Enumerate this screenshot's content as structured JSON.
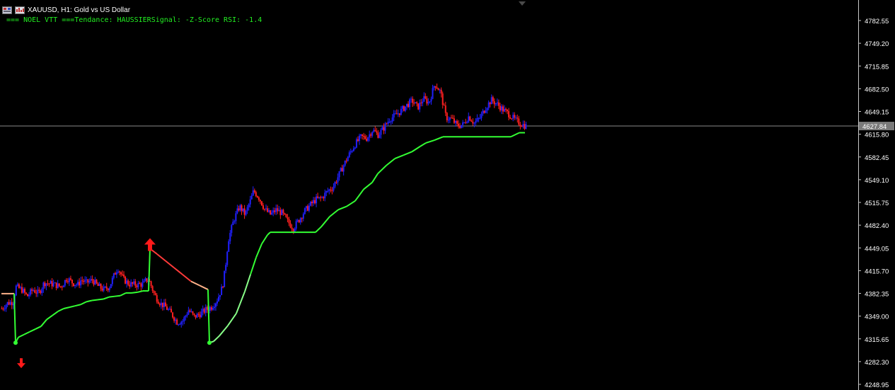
{
  "header": {
    "title": "XAUUSD, H1:  Gold vs US Dollar",
    "indicator_text": "=== NOEL VTT ===Tendance: HAUSSIERSignal: -Z-Score RSI: -1.4"
  },
  "colors": {
    "background": "#000000",
    "bull_candle": "#2020ff",
    "bear_candle": "#ff2020",
    "trend_up_line": "#33ff33",
    "trend_down_line": "#ff3a3a",
    "trend_transition": "#ffb38a",
    "indicator_text": "#22ee22",
    "axis_text": "#ffffff",
    "bid_line": "#8a8a8a",
    "arrow": "#ff1a1a"
  },
  "icons": [
    "chart-window-icon",
    "symbol-icon",
    "scroll-marker-icon",
    "buy-arrow-icon",
    "sell-arrow-icon"
  ],
  "chart_data": {
    "type": "candlestick",
    "symbol": "XAUUSD",
    "timeframe": "H1",
    "ylim": [
      4248.95,
      4799.0
    ],
    "y_ticks": [
      4782.55,
      4749.2,
      4715.85,
      4682.5,
      4649.15,
      4615.8,
      4582.45,
      4549.1,
      4515.75,
      4482.4,
      4449.05,
      4415.7,
      4382.35,
      4349.0,
      4315.65,
      4282.3,
      4248.95
    ],
    "current_price": 4627.84,
    "n_bars": 145,
    "bars_shown": 145,
    "price_path": [
      [
        0,
        4360
      ],
      [
        4,
        4368
      ],
      [
        8,
        4370
      ],
      [
        10,
        4392
      ],
      [
        14,
        4388
      ],
      [
        18,
        4378
      ],
      [
        22,
        4388
      ],
      [
        26,
        4382
      ],
      [
        30,
        4398
      ],
      [
        36,
        4396
      ],
      [
        42,
        4392
      ],
      [
        46,
        4405
      ],
      [
        50,
        4398
      ],
      [
        54,
        4395
      ],
      [
        56,
        4402
      ],
      [
        60,
        4398
      ],
      [
        64,
        4402
      ],
      [
        68,
        4393
      ],
      [
        72,
        4388
      ],
      [
        76,
        4392
      ],
      [
        80,
        4412
      ],
      [
        82,
        4420
      ],
      [
        86,
        4403
      ],
      [
        90,
        4396
      ],
      [
        96,
        4395
      ],
      [
        100,
        4396
      ],
      [
        102,
        4402
      ],
      [
        104,
        4402
      ],
      [
        108,
        4380
      ],
      [
        112,
        4368
      ],
      [
        116,
        4362
      ],
      [
        120,
        4352
      ],
      [
        124,
        4340
      ],
      [
        128,
        4342
      ],
      [
        132,
        4358
      ],
      [
        136,
        4348
      ],
      [
        140,
        4352
      ],
      [
        144,
        4358
      ],
      [
        148,
        4362
      ],
      [
        152,
        4372
      ],
      [
        156,
        4392
      ],
      [
        158,
        4420
      ],
      [
        160,
        4460
      ],
      [
        164,
        4490
      ],
      [
        168,
        4510
      ],
      [
        172,
        4498
      ],
      [
        176,
        4520
      ],
      [
        178,
        4533
      ],
      [
        182,
        4522
      ],
      [
        186,
        4505
      ],
      [
        190,
        4498
      ],
      [
        194,
        4505
      ],
      [
        198,
        4500
      ],
      [
        202,
        4488
      ],
      [
        206,
        4478
      ],
      [
        210,
        4490
      ],
      [
        214,
        4503
      ],
      [
        218,
        4512
      ],
      [
        222,
        4520
      ],
      [
        226,
        4522
      ],
      [
        230,
        4532
      ],
      [
        234,
        4538
      ],
      [
        238,
        4555
      ],
      [
        242,
        4572
      ],
      [
        246,
        4588
      ],
      [
        250,
        4602
      ],
      [
        254,
        4612
      ],
      [
        258,
        4610
      ],
      [
        262,
        4622
      ],
      [
        266,
        4615
      ],
      [
        270,
        4625
      ],
      [
        274,
        4638
      ],
      [
        278,
        4643
      ],
      [
        282,
        4650
      ],
      [
        286,
        4658
      ],
      [
        290,
        4665
      ],
      [
        294,
        4655
      ],
      [
        298,
        4668
      ],
      [
        302,
        4662
      ],
      [
        306,
        4690
      ],
      [
        310,
        4678
      ],
      [
        314,
        4640
      ],
      [
        318,
        4638
      ],
      [
        322,
        4628
      ],
      [
        326,
        4630
      ],
      [
        330,
        4642
      ],
      [
        334,
        4632
      ],
      [
        338,
        4640
      ],
      [
        342,
        4655
      ],
      [
        346,
        4666
      ],
      [
        350,
        4660
      ],
      [
        354,
        4652
      ],
      [
        358,
        4646
      ],
      [
        362,
        4638
      ],
      [
        366,
        4632
      ],
      [
        370,
        4628
      ]
    ],
    "trend_line": [
      [
        0,
        4382
      ],
      [
        9,
        4382
      ],
      [
        10,
        4310
      ],
      [
        12,
        4318
      ],
      [
        16,
        4322
      ],
      [
        20,
        4326
      ],
      [
        24,
        4330
      ],
      [
        28,
        4334
      ],
      [
        32,
        4344
      ],
      [
        36,
        4350
      ],
      [
        40,
        4356
      ],
      [
        44,
        4360
      ],
      [
        48,
        4362
      ],
      [
        52,
        4364
      ],
      [
        56,
        4366
      ],
      [
        60,
        4370
      ],
      [
        64,
        4372
      ],
      [
        68,
        4373
      ],
      [
        72,
        4374
      ],
      [
        76,
        4377
      ],
      [
        80,
        4378
      ],
      [
        84,
        4379
      ],
      [
        88,
        4383
      ],
      [
        92,
        4383
      ],
      [
        96,
        4384
      ],
      [
        100,
        4386
      ],
      [
        104,
        4386
      ],
      [
        105,
        4448
      ],
      [
        110,
        4440
      ],
      [
        116,
        4430
      ],
      [
        122,
        4420
      ],
      [
        128,
        4410
      ],
      [
        134,
        4400
      ],
      [
        140,
        4394
      ],
      [
        146,
        4388
      ],
      [
        147,
        4310
      ],
      [
        150,
        4312
      ],
      [
        154,
        4320
      ],
      [
        160,
        4335
      ],
      [
        166,
        4353
      ],
      [
        172,
        4385
      ],
      [
        176,
        4410
      ],
      [
        180,
        4435
      ],
      [
        184,
        4455
      ],
      [
        188,
        4468
      ],
      [
        190,
        4472
      ],
      [
        210,
        4472
      ],
      [
        222,
        4472
      ],
      [
        226,
        4480
      ],
      [
        232,
        4495
      ],
      [
        238,
        4505
      ],
      [
        244,
        4510
      ],
      [
        250,
        4518
      ],
      [
        256,
        4535
      ],
      [
        262,
        4545
      ],
      [
        266,
        4558
      ],
      [
        272,
        4570
      ],
      [
        278,
        4580
      ],
      [
        284,
        4585
      ],
      [
        290,
        4590
      ],
      [
        296,
        4598
      ],
      [
        300,
        4603
      ],
      [
        306,
        4607
      ],
      [
        312,
        4612
      ],
      [
        336,
        4612
      ],
      [
        360,
        4612
      ],
      [
        366,
        4618
      ],
      [
        370,
        4618
      ]
    ],
    "arrows": [
      {
        "type": "sell-arrow-icon",
        "bar": 14,
        "price": 4282
      },
      {
        "type": "buy-arrow-icon",
        "bar": 105,
        "price": 4453
      }
    ],
    "trend_markers": [
      {
        "bar": 10,
        "price": 4310
      },
      {
        "bar": 147,
        "price": 4310
      }
    ]
  }
}
